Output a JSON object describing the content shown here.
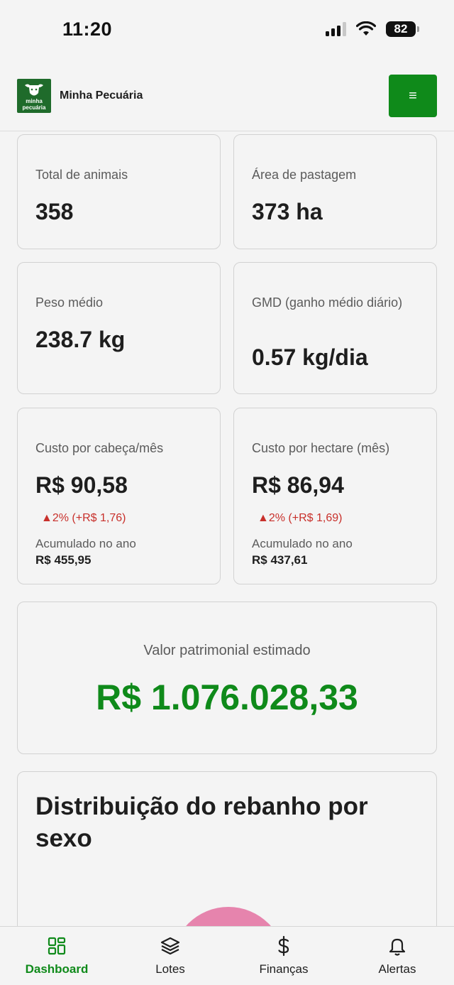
{
  "status_bar": {
    "time": "11:20",
    "battery": "82"
  },
  "header": {
    "logo_text_line1": "minha",
    "logo_text_line2": "pecuária",
    "title": "Minha Pecuária",
    "menu_icon": "≡"
  },
  "stats": {
    "total_animais": {
      "label": "Total de animais",
      "value": "358"
    },
    "area_pastagem": {
      "label": "Área de pastagem",
      "value": "373 ha"
    },
    "peso_medio": {
      "label": "Peso médio",
      "value": "238.7 kg"
    },
    "gmd": {
      "label": "GMD (ganho médio diário)",
      "value": "0.57 kg/dia"
    },
    "custo_cabeca": {
      "label": "Custo por cabeça/mês",
      "value": "R$ 90,58",
      "delta": "▲2% (+R$ 1,76)",
      "acc_label": "Acumulado no ano",
      "acc_value": "R$ 455,95"
    },
    "custo_hectare": {
      "label": "Custo por hectare (mês)",
      "value": "R$ 86,94",
      "delta": "▲2% (+R$ 1,69)",
      "acc_label": "Acumulado no ano",
      "acc_value": "R$ 437,61"
    }
  },
  "patrimonio": {
    "label": "Valor patrimonial estimado",
    "value": "R$ 1.076.028,33"
  },
  "distribution": {
    "title": "Distribuição do rebanho por sexo"
  },
  "colors": {
    "primary_green": "#0f8a1a",
    "delta_red": "#c8302b",
    "pie_pink": "#e684ad"
  },
  "bottom_nav": [
    {
      "label": "Dashboard",
      "icon": "grid-icon",
      "active": true
    },
    {
      "label": "Lotes",
      "icon": "layers-icon",
      "active": false
    },
    {
      "label": "Finanças",
      "icon": "dollar-icon",
      "active": false
    },
    {
      "label": "Alertas",
      "icon": "bell-icon",
      "active": false
    }
  ]
}
